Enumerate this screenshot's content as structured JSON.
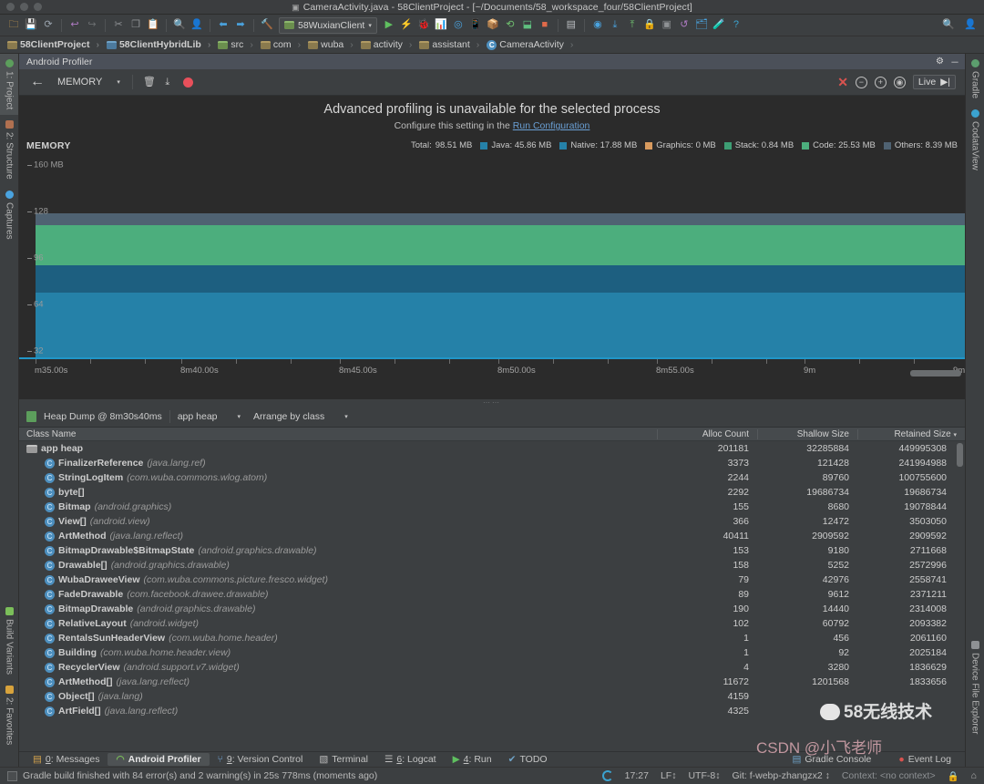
{
  "titlebar": {
    "title": "CameraActivity.java - 58ClientProject - [~/Documents/58_workspace_four/58ClientProject]",
    "window_icon": "file-icon"
  },
  "toolbar": {
    "icons": [
      "open-folder-icon",
      "save-all-icon",
      "sync-icon",
      "undo-icon",
      "redo-icon",
      "cut-icon",
      "copy-icon",
      "paste-icon",
      "find-icon",
      "find-usages-icon",
      "back-icon",
      "forward-icon",
      "build-hammer-icon"
    ],
    "run_config": "58WuxianClient",
    "run_label": "run-icon",
    "actions": [
      "run-icon",
      "apply-changes-icon",
      "debug-icon",
      "profile-icon",
      "attach-debugger-icon",
      "avd-manager-icon",
      "sdk-manager-icon",
      "gradle-sync-icon",
      "stop-icon",
      "layout-inspector-icon",
      "android-device-monitor-icon",
      "vcs-update-icon",
      "vcs-commit-icon",
      "lock-icon",
      "preview-icon",
      "revert-icon",
      "project-structure-icon",
      "sdk-icon",
      "help-icon"
    ],
    "right_icons": [
      "search-everywhere-icon",
      "account-icon"
    ]
  },
  "breadcrumbs": [
    {
      "label": "58ClientProject",
      "icon": "module-folder-icon",
      "bold": true
    },
    {
      "label": "58ClientHybridLib",
      "icon": "library-folder-icon",
      "bold": true
    },
    {
      "label": "src",
      "icon": "source-folder-icon",
      "bold": false
    },
    {
      "label": "com",
      "icon": "package-folder-icon",
      "bold": false
    },
    {
      "label": "wuba",
      "icon": "package-folder-icon",
      "bold": false
    },
    {
      "label": "activity",
      "icon": "package-folder-icon",
      "bold": false
    },
    {
      "label": "assistant",
      "icon": "package-folder-icon",
      "bold": false
    },
    {
      "label": "CameraActivity",
      "icon": "class-icon",
      "bold": false
    }
  ],
  "left_rail": [
    {
      "label": "1: Project",
      "icon": "project-icon",
      "selected": true
    },
    {
      "label": "2: Structure",
      "icon": "structure-icon",
      "selected": false
    },
    {
      "label": "Captures",
      "icon": "captures-icon",
      "selected": false
    },
    {
      "label": "Build Variants",
      "icon": "build-variants-icon",
      "selected": false
    },
    {
      "label": "2: Favorites",
      "icon": "favorites-star-icon",
      "selected": false
    }
  ],
  "right_rail": [
    {
      "label": "Gradle",
      "icon": "gradle-icon"
    },
    {
      "label": "CodataView",
      "icon": "codataview-icon"
    },
    {
      "label": "Device File Explorer",
      "icon": "device-file-explorer-icon"
    }
  ],
  "profiler": {
    "tab_title": "Android Profiler",
    "tab_settings_icon": "gear-icon",
    "tab_minimize_icon": "minimize-icon",
    "tab_close_icon": "close-icon",
    "back_icon": "back-arrow-icon",
    "session": "MEMORY",
    "session_caret": "chevron-down-icon",
    "trash_icon": "trash-icon",
    "export_icon": "export-icon",
    "record_icon": "record-dot-icon",
    "stop_icon": "close-x-icon",
    "zoom_out_icon": "zoom-out-icon",
    "zoom_in_icon": "zoom-in-icon",
    "reset_zoom_icon": "reset-zoom-icon",
    "live_label": "Live",
    "live_icon": "go-live-icon",
    "banner_title": "Advanced profiling is unavailable for the selected process",
    "banner_prefix": "Configure this setting in the ",
    "banner_link": "Run Configuration"
  },
  "chart_data": {
    "type": "area",
    "title": "MEMORY",
    "xlabel": "",
    "ylabel": "MB",
    "ylim": [
      0,
      160
    ],
    "yticks": [
      160,
      128,
      96,
      64,
      32
    ],
    "ytick_labels": [
      "160 MB",
      "128",
      "96",
      "64",
      "32"
    ],
    "grid": false,
    "legend_position": "top-right",
    "total_label": "Total:",
    "total_value": "98.51 MB",
    "series": [
      {
        "name": "Java",
        "label": "Java: 45.86 MB",
        "value": 45.86,
        "color": "#2581a8"
      },
      {
        "name": "Native",
        "label": "Native: 17.88 MB",
        "value": 17.88,
        "color": "#1a5f80"
      },
      {
        "name": "Graphics",
        "label": "Graphics: 0 MB",
        "value": 0,
        "color": "#d89a5e"
      },
      {
        "name": "Stack",
        "label": "Stack: 0.84 MB",
        "value": 0.84,
        "color": "#3d9e74"
      },
      {
        "name": "Code",
        "label": "Code: 25.53 MB",
        "value": 25.53,
        "color": "#4cae7d"
      },
      {
        "name": "Others",
        "label": "Others: 8.39 MB",
        "value": 8.39,
        "color": "#4f6272"
      }
    ],
    "xtick_labels": [
      "m35.00s",
      "8m40.00s",
      "8m45.00s",
      "8m50.00s",
      "8m55.00s",
      "9m",
      "9m"
    ]
  },
  "heap_toolbar": {
    "dump_icon": "heap-dump-icon",
    "dump_label": "Heap Dump @ 8m30s40ms",
    "heap_select": "app heap",
    "arrange_select": "Arrange by class",
    "caret_icon": "chevron-down-icon"
  },
  "table": {
    "columns": [
      "Class Name",
      "Alloc Count",
      "Shallow Size",
      "Retained Size"
    ],
    "sorted_column": "Retained Size",
    "sort_icon": "sort-desc-icon",
    "rows": [
      {
        "icon": "heap-folder-icon",
        "name": "app heap",
        "pkg": "",
        "indent": 0,
        "alloc": "201181",
        "shallow": "32285884",
        "retained": "449995308"
      },
      {
        "icon": "class-icon",
        "name": "FinalizerReference",
        "pkg": "(java.lang.ref)",
        "indent": 1,
        "alloc": "3373",
        "shallow": "121428",
        "retained": "241994988"
      },
      {
        "icon": "class-icon",
        "name": "StringLogItem",
        "pkg": "(com.wuba.commons.wlog.atom)",
        "indent": 1,
        "alloc": "2244",
        "shallow": "89760",
        "retained": "100755600"
      },
      {
        "icon": "class-icon",
        "name": "byte[]",
        "pkg": "",
        "indent": 1,
        "alloc": "2292",
        "shallow": "19686734",
        "retained": "19686734"
      },
      {
        "icon": "class-icon",
        "name": "Bitmap",
        "pkg": "(android.graphics)",
        "indent": 1,
        "alloc": "155",
        "shallow": "8680",
        "retained": "19078844"
      },
      {
        "icon": "class-icon",
        "name": "View[]",
        "pkg": "(android.view)",
        "indent": 1,
        "alloc": "366",
        "shallow": "12472",
        "retained": "3503050"
      },
      {
        "icon": "class-icon",
        "name": "ArtMethod",
        "pkg": "(java.lang.reflect)",
        "indent": 1,
        "alloc": "40411",
        "shallow": "2909592",
        "retained": "2909592"
      },
      {
        "icon": "class-icon",
        "name": "BitmapDrawable$BitmapState",
        "pkg": "(android.graphics.drawable)",
        "indent": 1,
        "alloc": "153",
        "shallow": "9180",
        "retained": "2711668"
      },
      {
        "icon": "class-icon",
        "name": "Drawable[]",
        "pkg": "(android.graphics.drawable)",
        "indent": 1,
        "alloc": "158",
        "shallow": "5252",
        "retained": "2572996"
      },
      {
        "icon": "class-icon",
        "name": "WubaDraweeView",
        "pkg": "(com.wuba.commons.picture.fresco.widget)",
        "indent": 1,
        "alloc": "79",
        "shallow": "42976",
        "retained": "2558741"
      },
      {
        "icon": "class-icon",
        "name": "FadeDrawable",
        "pkg": "(com.facebook.drawee.drawable)",
        "indent": 1,
        "alloc": "89",
        "shallow": "9612",
        "retained": "2371211"
      },
      {
        "icon": "class-icon",
        "name": "BitmapDrawable",
        "pkg": "(android.graphics.drawable)",
        "indent": 1,
        "alloc": "190",
        "shallow": "14440",
        "retained": "2314008"
      },
      {
        "icon": "class-icon",
        "name": "RelativeLayout",
        "pkg": "(android.widget)",
        "indent": 1,
        "alloc": "102",
        "shallow": "60792",
        "retained": "2093382"
      },
      {
        "icon": "class-icon",
        "name": "RentalsSunHeaderView",
        "pkg": "(com.wuba.home.header)",
        "indent": 1,
        "alloc": "1",
        "shallow": "456",
        "retained": "2061160"
      },
      {
        "icon": "class-icon",
        "name": "Building",
        "pkg": "(com.wuba.home.header.view)",
        "indent": 1,
        "alloc": "1",
        "shallow": "92",
        "retained": "2025184"
      },
      {
        "icon": "class-icon",
        "name": "RecyclerView",
        "pkg": "(android.support.v7.widget)",
        "indent": 1,
        "alloc": "4",
        "shallow": "3280",
        "retained": "1836629"
      },
      {
        "icon": "class-icon",
        "name": "ArtMethod[]",
        "pkg": "(java.lang.reflect)",
        "indent": 1,
        "alloc": "11672",
        "shallow": "1201568",
        "retained": "1833656"
      },
      {
        "icon": "class-icon",
        "name": "Object[]",
        "pkg": "(java.lang)",
        "indent": 1,
        "alloc": "4159",
        "shallow": "",
        "retained": ""
      },
      {
        "icon": "class-icon",
        "name": "ArtField[]",
        "pkg": "(java.lang.reflect)",
        "indent": 1,
        "alloc": "4325",
        "shallow": "",
        "retained": ""
      }
    ]
  },
  "bottom_tabs": [
    {
      "num": "0",
      "label": ": Messages",
      "icon": "messages-icon",
      "selected": false
    },
    {
      "num": "",
      "label": "Android Profiler",
      "icon": "profiler-icon",
      "selected": true
    },
    {
      "num": "9",
      "label": ": Version Control",
      "icon": "version-control-icon",
      "selected": false
    },
    {
      "num": "",
      "label": "Terminal",
      "icon": "terminal-icon",
      "selected": false
    },
    {
      "num": "6",
      "label": ": Logcat",
      "icon": "logcat-icon",
      "selected": false
    },
    {
      "num": "4",
      "label": ": Run",
      "icon": "run-icon",
      "selected": false
    },
    {
      "num": "",
      "label": "TODO",
      "icon": "todo-icon",
      "selected": false
    }
  ],
  "bottom_right": [
    {
      "label": "Gradle Console",
      "icon": "gradle-console-icon"
    },
    {
      "label": "Event Log",
      "icon": "event-log-icon"
    }
  ],
  "status": {
    "build_message": "Gradle build finished with 84 error(s) and 2 warning(s) in 25s 778ms (moments ago)",
    "time": "17:27",
    "line_sep": "LF↕",
    "encoding": "UTF-8↕",
    "git": "Git: f-webp-zhangzx2 ↕",
    "context": "Context: <no context>",
    "lock_icon": "lock-icon",
    "notify_icon": "notification-icon",
    "sync_icon": "sync-spinner-icon"
  },
  "watermarks": {
    "wechat": "58无线技术",
    "csdn": "CSDN @小飞老师"
  }
}
